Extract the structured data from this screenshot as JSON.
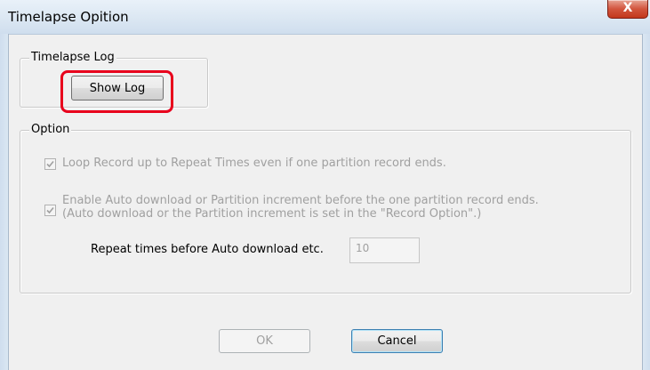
{
  "window": {
    "title": "Timelapse Opition",
    "close_label": "X"
  },
  "timelapse_log": {
    "legend": "Timelapse Log",
    "show_log_label": "Show Log"
  },
  "option": {
    "legend": "Option",
    "loop_record": {
      "label": "Loop Record up to Repeat Times even if one partition record ends.",
      "checked": true,
      "enabled": false
    },
    "auto_download": {
      "label_line1": "Enable Auto download or Partition increment before the one partition record ends.",
      "label_line2": "(Auto download or the Partition increment is set in the \"Record Option\".)",
      "checked": true,
      "enabled": false
    },
    "repeat_times": {
      "label": "Repeat times before Auto download etc.",
      "value": "10"
    }
  },
  "footer": {
    "ok_label": "OK",
    "cancel_label": "Cancel"
  },
  "colors": {
    "highlight": "#e8001c",
    "disabled_text": "#a0a0a0"
  }
}
